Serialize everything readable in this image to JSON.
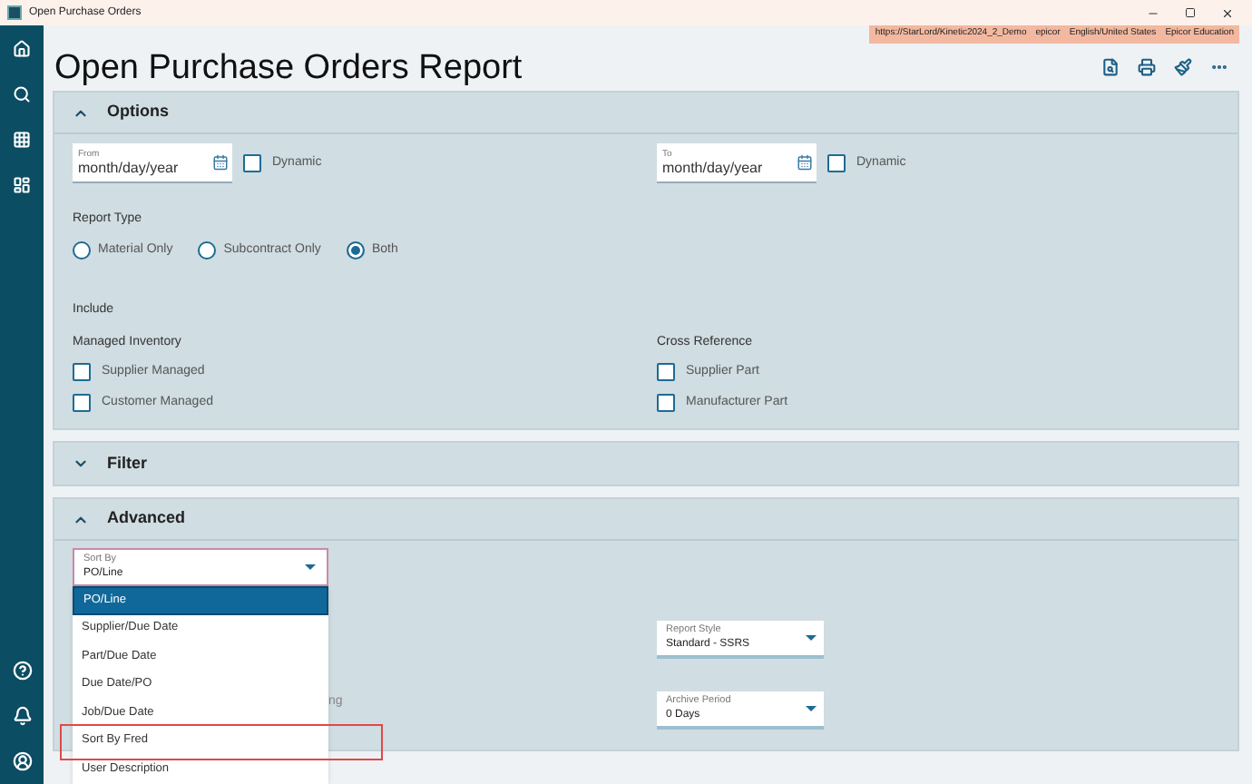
{
  "window": {
    "title": "Open Purchase Orders"
  },
  "info_bar": [
    "https://StarLord/Kinetic2024_2_Demo",
    "epicor",
    "English/United States",
    "Epicor Education"
  ],
  "page": {
    "title": "Open Purchase Orders Report"
  },
  "options": {
    "title": "Options",
    "expanded": true,
    "from": {
      "label": "From",
      "placeholder": "month/day/year",
      "dynamic": {
        "label": "Dynamic",
        "checked": false
      }
    },
    "to": {
      "label": "To",
      "placeholder": "month/day/year",
      "dynamic": {
        "label": "Dynamic",
        "checked": false
      }
    },
    "report_type": {
      "label": "Report Type",
      "options": [
        {
          "label": "Material Only",
          "selected": false
        },
        {
          "label": "Subcontract Only",
          "selected": false
        },
        {
          "label": "Both",
          "selected": true
        }
      ]
    },
    "include": {
      "label": "Include",
      "groups": [
        {
          "label": "Managed Inventory",
          "items": [
            {
              "label": "Supplier Managed",
              "checked": false
            },
            {
              "label": "Customer Managed",
              "checked": false
            }
          ]
        },
        {
          "label": "Cross Reference",
          "items": [
            {
              "label": "Supplier Part",
              "checked": false
            },
            {
              "label": "Manufacturer Part",
              "checked": false
            }
          ]
        }
      ]
    }
  },
  "filter": {
    "title": "Filter",
    "expanded": false
  },
  "advanced": {
    "title": "Advanced",
    "expanded": true,
    "sort_by": {
      "label": "Sort By",
      "value": "PO/Line",
      "options": [
        {
          "label": "PO/Line",
          "selected": true,
          "annotated": false
        },
        {
          "label": "Supplier/Due Date",
          "selected": false,
          "annotated": false
        },
        {
          "label": "Part/Due Date",
          "selected": false,
          "annotated": false
        },
        {
          "label": "Due Date/PO",
          "selected": false,
          "annotated": false
        },
        {
          "label": "Job/Due Date",
          "selected": false,
          "annotated": false
        },
        {
          "label": "Sort By Fred",
          "selected": false,
          "annotated": true
        },
        {
          "label": "User Description",
          "selected": false,
          "annotated": false
        }
      ]
    },
    "covered_label": "ng",
    "report_style": {
      "label": "Report Style",
      "value": "Standard - SSRS"
    },
    "archive_period": {
      "label": "Archive Period",
      "value": "0 Days"
    }
  }
}
